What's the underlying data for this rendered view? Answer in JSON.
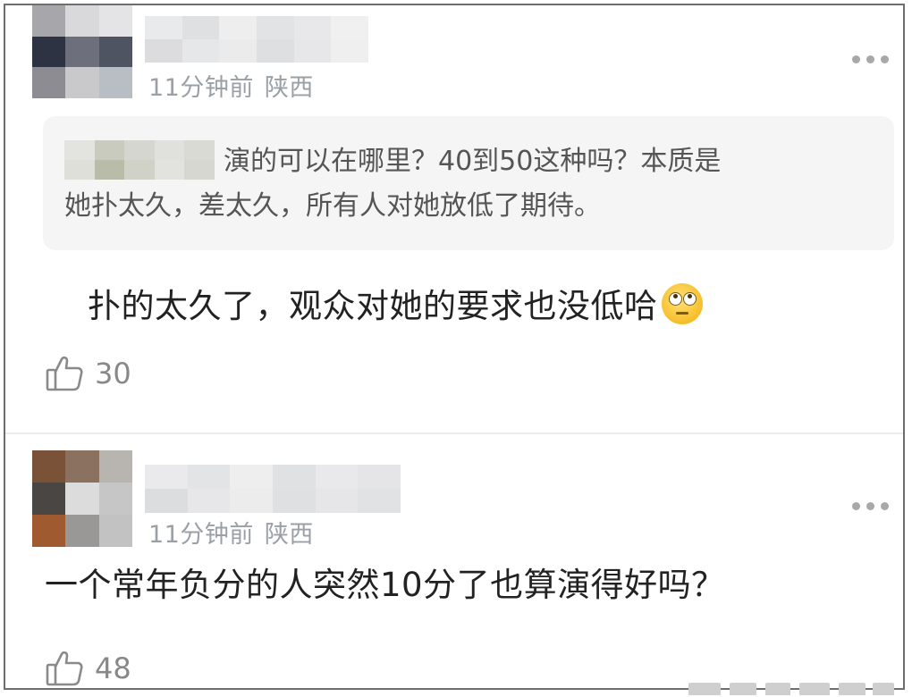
{
  "comments": [
    {
      "meta_time": "11分钟前",
      "meta_location": "陕西",
      "quote_text_line1": "演的可以在哪里？40到50这种吗？本质是",
      "quote_text_line2": "她扑太久，差太久，所有人对她放低了期待。",
      "body": "扑的太久了，观众对她的要求也没低哈",
      "emoji_icon": "face-with-rolling-eyes-icon",
      "likes": "30"
    },
    {
      "meta_time": "11分钟前",
      "meta_location": "陕西",
      "body": "一个常年负分的人突然10分了也算演得好吗？",
      "likes": "48"
    }
  ],
  "icons": {
    "more": "more-horizontal-icon",
    "like": "thumbs-up-icon"
  },
  "colors": {
    "meta_text": "#9aa0a6",
    "body_text": "#222222",
    "quote_bg": "#f5f5f5"
  }
}
